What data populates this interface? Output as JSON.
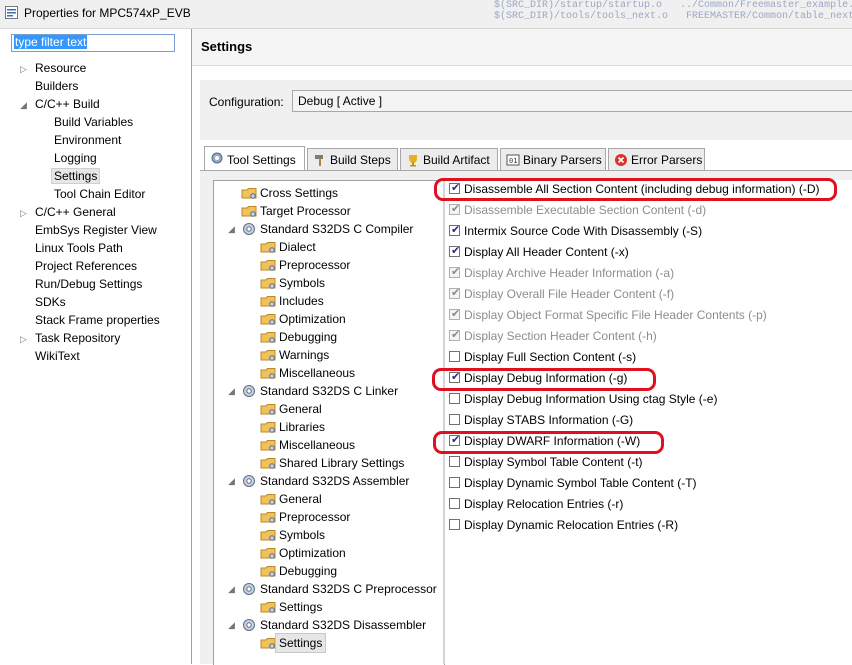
{
  "window": {
    "title": "Properties for MPC574xP_EVB",
    "background_code": [
      "         $(SRC_DIR)/startup/startup.o   ../Common/Freemaster_example.c",
      "         $(SRC_DIR)/tools/tools_next.o   FREEMASTER/Common/table_next.table"
    ]
  },
  "filter": {
    "placeholder": "type filter text"
  },
  "nav": {
    "items": [
      {
        "label": "Resource"
      },
      {
        "label": "Builders"
      },
      {
        "label": "C/C++ Build"
      },
      {
        "label": "Build Variables"
      },
      {
        "label": "Environment"
      },
      {
        "label": "Logging"
      },
      {
        "label": "Settings"
      },
      {
        "label": "Tool Chain Editor"
      },
      {
        "label": "C/C++ General"
      },
      {
        "label": "EmbSys Register View"
      },
      {
        "label": "Linux Tools Path"
      },
      {
        "label": "Project References"
      },
      {
        "label": "Run/Debug Settings"
      },
      {
        "label": "SDKs"
      },
      {
        "label": "Stack Frame properties"
      },
      {
        "label": "Task Repository"
      },
      {
        "label": "WikiText"
      }
    ]
  },
  "page": {
    "title": "Settings"
  },
  "config": {
    "label": "Configuration:",
    "value": "Debug  [ Active ]"
  },
  "tabs": [
    {
      "label": "Tool Settings",
      "icon": "gear-icon"
    },
    {
      "label": "Build Steps",
      "icon": "hammer-icon"
    },
    {
      "label": "Build Artifact",
      "icon": "trophy-icon"
    },
    {
      "label": "Binary Parsers",
      "icon": "binary-icon"
    },
    {
      "label": "Error Parsers",
      "icon": "error-icon"
    }
  ],
  "tool_tree": [
    {
      "label": "Cross Settings"
    },
    {
      "label": "Target Processor"
    },
    {
      "label": "Standard S32DS C Compiler"
    },
    {
      "label": "Dialect"
    },
    {
      "label": "Preprocessor"
    },
    {
      "label": "Symbols"
    },
    {
      "label": "Includes"
    },
    {
      "label": "Optimization"
    },
    {
      "label": "Debugging"
    },
    {
      "label": "Warnings"
    },
    {
      "label": "Miscellaneous"
    },
    {
      "label": "Standard S32DS C Linker"
    },
    {
      "label": "General"
    },
    {
      "label": "Libraries"
    },
    {
      "label": "Miscellaneous"
    },
    {
      "label": "Shared Library Settings"
    },
    {
      "label": "Standard S32DS Assembler"
    },
    {
      "label": "General"
    },
    {
      "label": "Preprocessor"
    },
    {
      "label": "Symbols"
    },
    {
      "label": "Optimization"
    },
    {
      "label": "Debugging"
    },
    {
      "label": "Standard S32DS C Preprocessor"
    },
    {
      "label": "Settings"
    },
    {
      "label": "Standard S32DS Disassembler"
    },
    {
      "label": "Settings"
    }
  ],
  "options": [
    {
      "label": "Disassemble All Section Content (including debug information) (-D)",
      "checked": true,
      "enabled": true
    },
    {
      "label": "Disassemble Executable Section Content (-d)",
      "checked": true,
      "enabled": false
    },
    {
      "label": "Intermix Source Code With Disassembly (-S)",
      "checked": true,
      "enabled": true
    },
    {
      "label": "Display All Header Content (-x)",
      "checked": true,
      "enabled": true
    },
    {
      "label": "Display Archive Header Information (-a)",
      "checked": true,
      "enabled": false
    },
    {
      "label": "Display Overall File Header Content (-f)",
      "checked": true,
      "enabled": false
    },
    {
      "label": "Display Object Format Specific File Header Contents (-p)",
      "checked": true,
      "enabled": false
    },
    {
      "label": "Display Section Header Content (-h)",
      "checked": true,
      "enabled": false
    },
    {
      "label": "Display Full Section Content (-s)",
      "checked": false,
      "enabled": true
    },
    {
      "label": "Display Debug Information (-g)",
      "checked": true,
      "enabled": true
    },
    {
      "label": "Display Debug Information Using ctag Style (-e)",
      "checked": false,
      "enabled": true
    },
    {
      "label": "Display STABS Information (-G)",
      "checked": false,
      "enabled": true
    },
    {
      "label": "Display DWARF Information (-W)",
      "checked": true,
      "enabled": true
    },
    {
      "label": "Display Symbol Table Content (-t)",
      "checked": false,
      "enabled": true
    },
    {
      "label": "Display Dynamic Symbol Table Content (-T)",
      "checked": false,
      "enabled": true
    },
    {
      "label": "Display Relocation Entries (-r)",
      "checked": false,
      "enabled": true
    },
    {
      "label": "Display Dynamic Relocation Entries (-R)",
      "checked": false,
      "enabled": true
    }
  ],
  "colors": {
    "highlight": "#e0101f",
    "selection": "#3399ff"
  }
}
